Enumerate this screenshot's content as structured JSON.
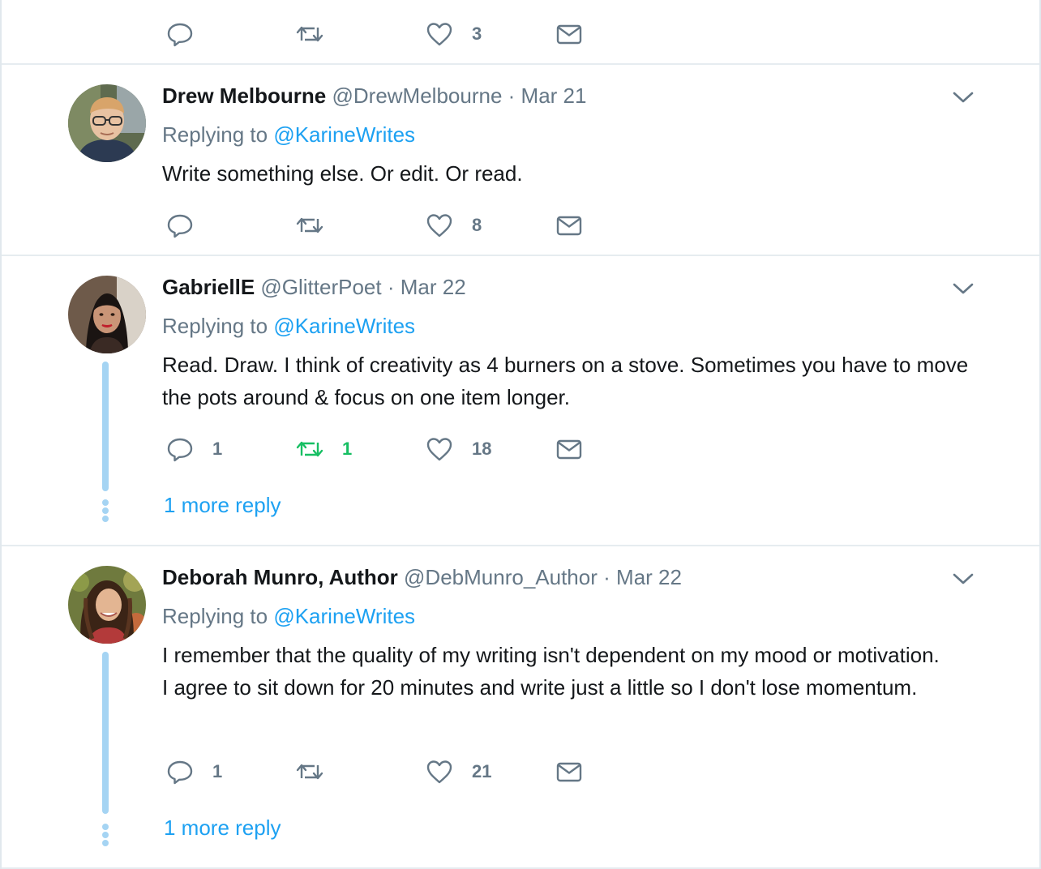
{
  "colors": {
    "accent": "#1da1f2",
    "muted": "#657786",
    "retweet_active": "#17bf63",
    "thread": "#a5d4f3"
  },
  "icons": {
    "reply": "reply-bubble-icon",
    "retweet": "retweet-icon",
    "like": "heart-icon",
    "dm": "envelope-icon",
    "caret": "chevron-down-icon"
  },
  "top_actions": {
    "reply_count": "",
    "retweet_count": "",
    "like_count": "3"
  },
  "tweets": [
    {
      "name": "Drew Melbourne",
      "handle": "@DrewMelbourne",
      "dot": "·",
      "date": "Mar 21",
      "replying_prefix": "Replying to ",
      "replying_to": "@KarineWrites",
      "text": "Write something else. Or edit. Or read.",
      "reply_count": "",
      "retweet_count": "",
      "like_count": "8"
    },
    {
      "name": "GabriellE",
      "handle": "@GlitterPoet",
      "dot": "·",
      "date": "Mar 22",
      "replying_prefix": "Replying to ",
      "replying_to": "@KarineWrites",
      "text": "Read. Draw. I think of creativity as 4 burners on a stove. Sometimes you have to move the pots around & focus on one item longer.",
      "reply_count": "1",
      "retweet_count": "1",
      "like_count": "18",
      "more_reply": "1 more reply"
    },
    {
      "name": "Deborah Munro, Author",
      "handle": "@DebMunro_Author",
      "dot": "·",
      "date": "Mar 22",
      "replying_prefix": "Replying to ",
      "replying_to": "@KarineWrites",
      "text": "I remember that the quality of my writing isn't dependent on my mood or motivation. I agree to sit down for 20 minutes and write just a little so I don't lose momentum.",
      "reply_count": "1",
      "retweet_count": "",
      "like_count": "21",
      "more_reply": "1 more reply"
    }
  ]
}
